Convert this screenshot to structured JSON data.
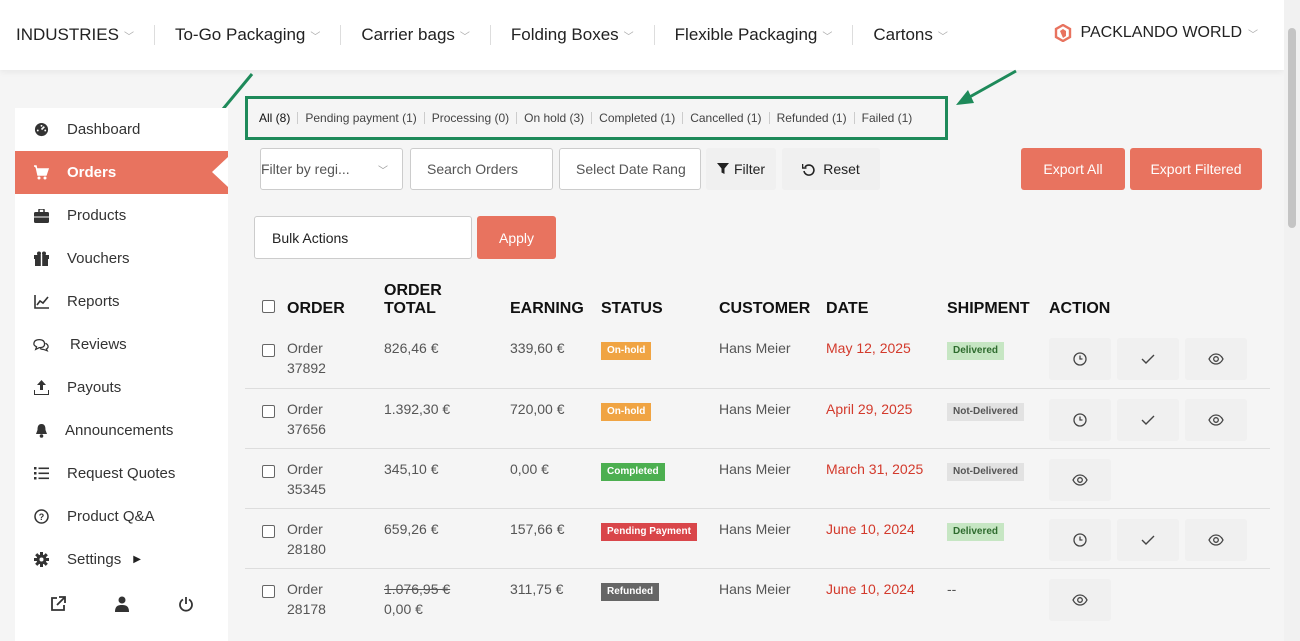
{
  "topnav": {
    "items": [
      "INDUSTRIES",
      "To-Go Packaging",
      "Carrier bags",
      "Folding Boxes",
      "Flexible Packaging",
      "Cartons"
    ],
    "brand": "PACKLANDO WORLD"
  },
  "sidebar": {
    "items": [
      {
        "label": "Dashboard",
        "icon": "dashboard-icon"
      },
      {
        "label": "Orders",
        "icon": "cart-icon"
      },
      {
        "label": "Products",
        "icon": "briefcase-icon"
      },
      {
        "label": "Vouchers",
        "icon": "gift-icon"
      },
      {
        "label": "Reports",
        "icon": "chart-icon"
      },
      {
        "label": "Reviews",
        "icon": "comments-icon"
      },
      {
        "label": "Payouts",
        "icon": "upload-icon"
      },
      {
        "label": "Announcements",
        "icon": "bell-icon"
      },
      {
        "label": "Request Quotes",
        "icon": "list-icon"
      },
      {
        "label": "Product Q&A",
        "icon": "question-icon"
      },
      {
        "label": "Settings",
        "icon": "gear-icon"
      }
    ]
  },
  "tabs": [
    "All (8)",
    "Pending payment (1)",
    "Processing (0)",
    "On hold (3)",
    "Completed (1)",
    "Cancelled (1)",
    "Refunded (1)",
    "Failed (1)"
  ],
  "filters": {
    "region": "Filter by regi...",
    "search_placeholder": "Search Orders",
    "date_placeholder": "Select Date Rang",
    "filter": "Filter",
    "reset": "Reset",
    "export_all": "Export All",
    "export_filtered": "Export Filtered"
  },
  "bulk": {
    "label": "Bulk Actions",
    "apply": "Apply"
  },
  "table": {
    "headers": {
      "order": "ORDER",
      "total_1": "ORDER",
      "total_2": "TOTAL",
      "earning": "EARNING",
      "status": "STATUS",
      "customer": "CUSTOMER",
      "date": "DATE",
      "shipment": "SHIPMENT",
      "action": "ACTION"
    },
    "rows": [
      {
        "order_1": "Order",
        "order_2": "37892",
        "total": "826,46 €",
        "total_old": "",
        "earning": "339,60 €",
        "status": "On-hold",
        "customer": "Hans Meier",
        "date": "May 12, 2025",
        "shipment": "Delivered"
      },
      {
        "order_1": "Order",
        "order_2": "37656",
        "total": "1.392,30 €",
        "total_old": "",
        "earning": "720,00 €",
        "status": "On-hold",
        "customer": "Hans Meier",
        "date": "April 29, 2025",
        "shipment": "Not-Delivered"
      },
      {
        "order_1": "Order",
        "order_2": "35345",
        "total": "345,10 €",
        "total_old": "",
        "earning": "0,00 €",
        "status": "Completed",
        "customer": "Hans Meier",
        "date": "March 31, 2025",
        "shipment": "Not-Delivered"
      },
      {
        "order_1": "Order",
        "order_2": "28180",
        "total": "659,26 €",
        "total_old": "",
        "earning": "157,66 €",
        "status": "Pending Payment",
        "customer": "Hans Meier",
        "date": "June 10, 2024",
        "shipment": "Delivered"
      },
      {
        "order_1": "Order",
        "order_2": "28178",
        "total": "0,00 €",
        "total_old": "1.076,95 €",
        "earning": "311,75 €",
        "status": "Refunded",
        "customer": "Hans Meier",
        "date": "June 10, 2024",
        "shipment": "--"
      }
    ]
  },
  "colors": {
    "accent": "#e8735f",
    "annotation": "#1e8a5a",
    "onhold": "#f0a443",
    "completed": "#4caf50",
    "pending": "#d9464a",
    "refunded": "#666666"
  }
}
